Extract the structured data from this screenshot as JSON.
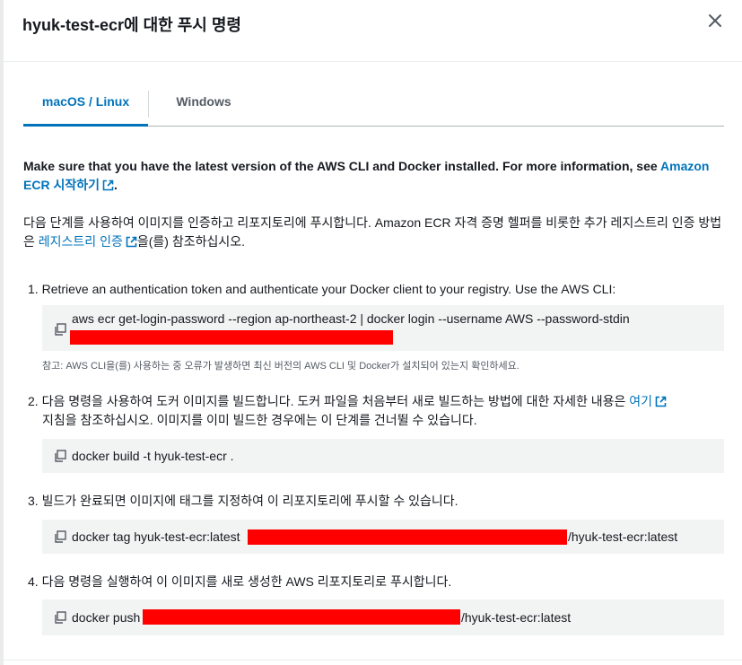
{
  "modal": {
    "title": "hyuk-test-ecr에 대한 푸시 명령",
    "close_icon": "close-icon"
  },
  "tabs": [
    {
      "label": "macOS / Linux",
      "active": true
    },
    {
      "label": "Windows",
      "active": false
    }
  ],
  "intro": {
    "text": "Make sure that you have the latest version of the AWS CLI and Docker installed. For more information, see ",
    "link_label": "Amazon ECR 시작하기",
    "suffix": "."
  },
  "auth_note": {
    "text": "다음 단계를 사용하여 이미지를 인증하고 리포지토리에 푸시합니다. Amazon ECR 자격 증명 헬퍼를 비롯한 추가 레지스트리 인증 방법은 ",
    "link_label": "레지스트리 인증",
    "suffix": "을(를) 참조하십시오."
  },
  "steps": [
    {
      "num": "1.",
      "text": "Retrieve an authentication token and authenticate your Docker client to your registry. Use the AWS CLI:",
      "command": "aws ecr get-login-password --region ap-northeast-2 | docker login --username AWS --password-stdin",
      "hint": "참고: AWS CLI을(를) 사용하는 중 오류가 발생하면 최신 버전의 AWS CLI 및 Docker가 설치되어 있는지 확인하세요."
    },
    {
      "num": "2.",
      "text": "다음 명령을 사용하여 도커 이미지를 빌드합니다. 도커 파일을 처음부터 새로 빌드하는 방법에 대한 자세한 내용은 ",
      "link_label": "여기",
      "text2": "지침을 참조하십시오. 이미지를 이미 빌드한 경우에는 이 단계를 건너뛸 수 있습니다.",
      "command": "docker build -t hyuk-test-ecr ."
    },
    {
      "num": "3.",
      "text": "빌드가 완료되면 이미지에 태그를 지정하여 이 리포지토리에 푸시할 수 있습니다.",
      "command_prefix": "docker tag hyuk-test-ecr:latest ",
      "command_suffix": "/hyuk-test-ecr:latest"
    },
    {
      "num": "4.",
      "text": "다음 명령을 실행하여 이 이미지를 새로 생성한 AWS 리포지토리로 푸시합니다.",
      "command_prefix": "docker push ",
      "command_suffix": "/hyuk-test-ecr:latest"
    }
  ],
  "icons": {
    "copy": "copy-icon",
    "external_link": "external-link-icon"
  },
  "colors": {
    "link": "#0073bb",
    "code_bg": "#f2f3f3",
    "redaction": "#ff0000"
  }
}
